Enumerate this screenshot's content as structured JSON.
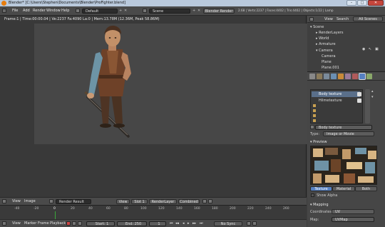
{
  "titlebar": {
    "title": "Blender* [C:\\Users\\Stephen\\Documents\\Blender\\ProFighter.blend]"
  },
  "menubar": {
    "menus": [
      "File",
      "Add",
      "Render",
      "Window",
      "Help"
    ],
    "layout": "Default",
    "scene": "Scene",
    "engine": "Blender Render",
    "stats": "2.68 | Verts:2237 | Faces:4402 | Tris:4402 | Objects:1/22 | Lamp"
  },
  "viewport": {
    "header": "Frame:1 | Time:00:00.04 | Ve:2237 Fa:4090 La:0 | Mem:13.78M (12.36M, Peak 58.86M)"
  },
  "image_header": {
    "items": [
      "View",
      "Image"
    ],
    "image_name": "Render Result",
    "view": "View",
    "slot": "Slot 1",
    "layer": "RenderLayer",
    "pass": "Combined"
  },
  "timeline": {
    "ticks": [
      "-40",
      "-20",
      "0",
      "20",
      "40",
      "60",
      "80",
      "100",
      "120",
      "140",
      "160",
      "180",
      "200",
      "220",
      "240",
      "260"
    ],
    "current_frame": "1"
  },
  "timeline_header": {
    "items": [
      "View",
      "Marker",
      "Frame",
      "Playback"
    ],
    "start": "Start: 1",
    "end": "End: 250",
    "frame": "1",
    "sync": "No Sync"
  },
  "outliner": {
    "menu": [
      "View",
      "Search"
    ],
    "filter": "All Scenes",
    "rows": [
      "Scene",
      "RenderLayers",
      "World",
      "Armature",
      "Camera",
      "Camera",
      "Plane",
      "Plane.001"
    ]
  },
  "properties": {
    "tex_slots": [
      "Body texture",
      "Hilmetexture"
    ],
    "tex_name": "Body texture",
    "type_label": "Type:",
    "type_value": "Image or Movie",
    "preview_label": "Preview",
    "preview_tabs": [
      "Texture",
      "Material",
      "Both"
    ],
    "show_alpha": "Show Alpha",
    "mapping_label": "Mapping",
    "coordinates_label": "Coordinates:",
    "coordinates_value": "UV",
    "map_label": "Map:",
    "map_value": "UVMap"
  },
  "colors": {
    "blender_orange": "#e87d0d",
    "selection_blue": "#5a6f8a",
    "tab_active": "#5680c2",
    "playhead": "#3aa83a"
  }
}
